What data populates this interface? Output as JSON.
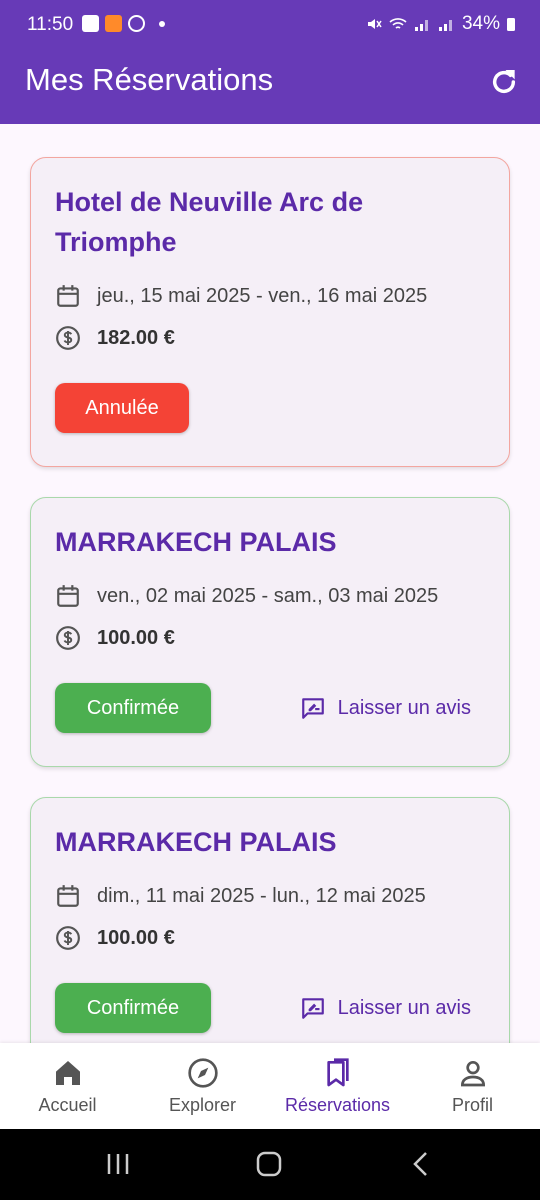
{
  "status": {
    "time": "11:50",
    "battery": "34%"
  },
  "header": {
    "title": "Mes Réservations"
  },
  "reservations": [
    {
      "hotel": "Hotel de Neuville Arc de Triomphe",
      "dates": "jeu., 15 mai 2025 - ven., 16 mai 2025",
      "price": "182.00 €",
      "status": "Annulée",
      "status_color": "#f44336"
    },
    {
      "hotel": "MARRAKECH PALAIS",
      "dates": "ven., 02 mai 2025 - sam., 03 mai 2025",
      "price": "100.00 €",
      "status": "Confirmée",
      "status_color": "#4caf50",
      "action": "Laisser un avis"
    },
    {
      "hotel": "MARRAKECH PALAIS",
      "dates": "dim., 11 mai 2025 - lun., 12 mai 2025",
      "price": "100.00 €",
      "status": "Confirmée",
      "status_color": "#4caf50",
      "action": "Laisser un avis"
    }
  ],
  "bottom_nav": [
    {
      "label": "Accueil",
      "icon": "home-icon"
    },
    {
      "label": "Explorer",
      "icon": "compass-icon"
    },
    {
      "label": "Réservations",
      "icon": "bookmarks-icon",
      "active": true
    },
    {
      "label": "Profil",
      "icon": "person-icon"
    }
  ],
  "colors": {
    "primary": "#673ab7",
    "accent_text": "#5b2aa8",
    "background": "#fdf7fe",
    "card": "#f5eff7"
  }
}
